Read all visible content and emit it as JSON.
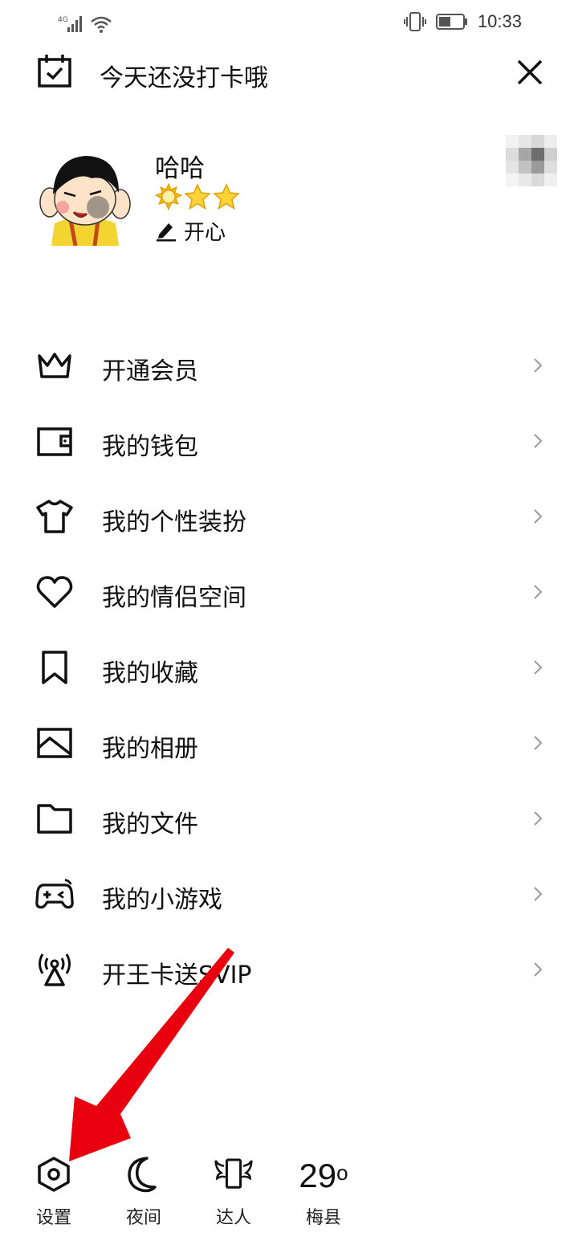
{
  "status_bar": {
    "network": "4G",
    "time": "10:33"
  },
  "header": {
    "checkin_text": "今天还没打卡哦"
  },
  "profile": {
    "name": "哈哈",
    "mood": "开心"
  },
  "menu": {
    "items": [
      {
        "label": "开通会员",
        "icon": "crown-icon"
      },
      {
        "label": "我的钱包",
        "icon": "wallet-icon"
      },
      {
        "label": "我的个性装扮",
        "icon": "tshirt-icon"
      },
      {
        "label": "我的情侣空间",
        "icon": "heart-icon"
      },
      {
        "label": "我的收藏",
        "icon": "bookmark-icon"
      },
      {
        "label": "我的相册",
        "icon": "photo-icon"
      },
      {
        "label": "我的文件",
        "icon": "folder-icon"
      },
      {
        "label": "我的小游戏",
        "icon": "gamepad-icon"
      },
      {
        "label": "开王卡送SVIP",
        "icon": "signal-tower-icon"
      }
    ]
  },
  "bottom_bar": {
    "settings_label": "设置",
    "night_label": "夜间",
    "expert_label": "达人",
    "temperature": "29",
    "temperature_unit": "o",
    "location": "梅县"
  },
  "colors": {
    "annotation_arrow": "#e8000f",
    "star_gold": "#f5b800",
    "text": "#111111"
  }
}
